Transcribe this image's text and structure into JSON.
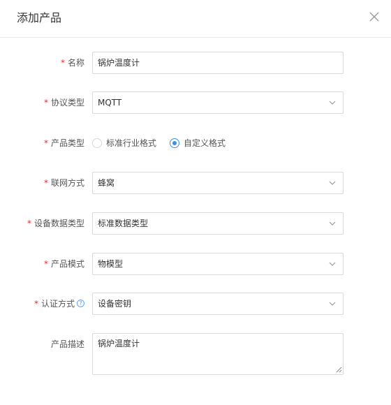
{
  "dialog": {
    "title": "添加产品",
    "close_icon": "close-icon"
  },
  "form": {
    "name": {
      "label": "名称",
      "required": true,
      "value": "锅炉温度计"
    },
    "protocol_type": {
      "label": "协议类型",
      "required": true,
      "value": "MQTT"
    },
    "product_type": {
      "label": "产品类型",
      "required": true,
      "options": [
        "标准行业格式",
        "自定义格式"
      ],
      "selected": "自定义格式"
    },
    "network_mode": {
      "label": "联网方式",
      "required": true,
      "value": "蜂窝"
    },
    "device_data_type": {
      "label": "设备数据类型",
      "required": true,
      "value": "标准数据类型"
    },
    "product_mode": {
      "label": "产品模式",
      "required": true,
      "value": "物模型"
    },
    "auth_method": {
      "label": "认证方式",
      "required": true,
      "value": "设备密钥",
      "help_icon": "question-circle-icon"
    },
    "description": {
      "label": "产品描述",
      "required": false,
      "value": "锅炉温度计"
    }
  },
  "colors": {
    "required_star": "#e8292b",
    "accent": "#3a8ee6",
    "border": "#d9d9d9"
  }
}
